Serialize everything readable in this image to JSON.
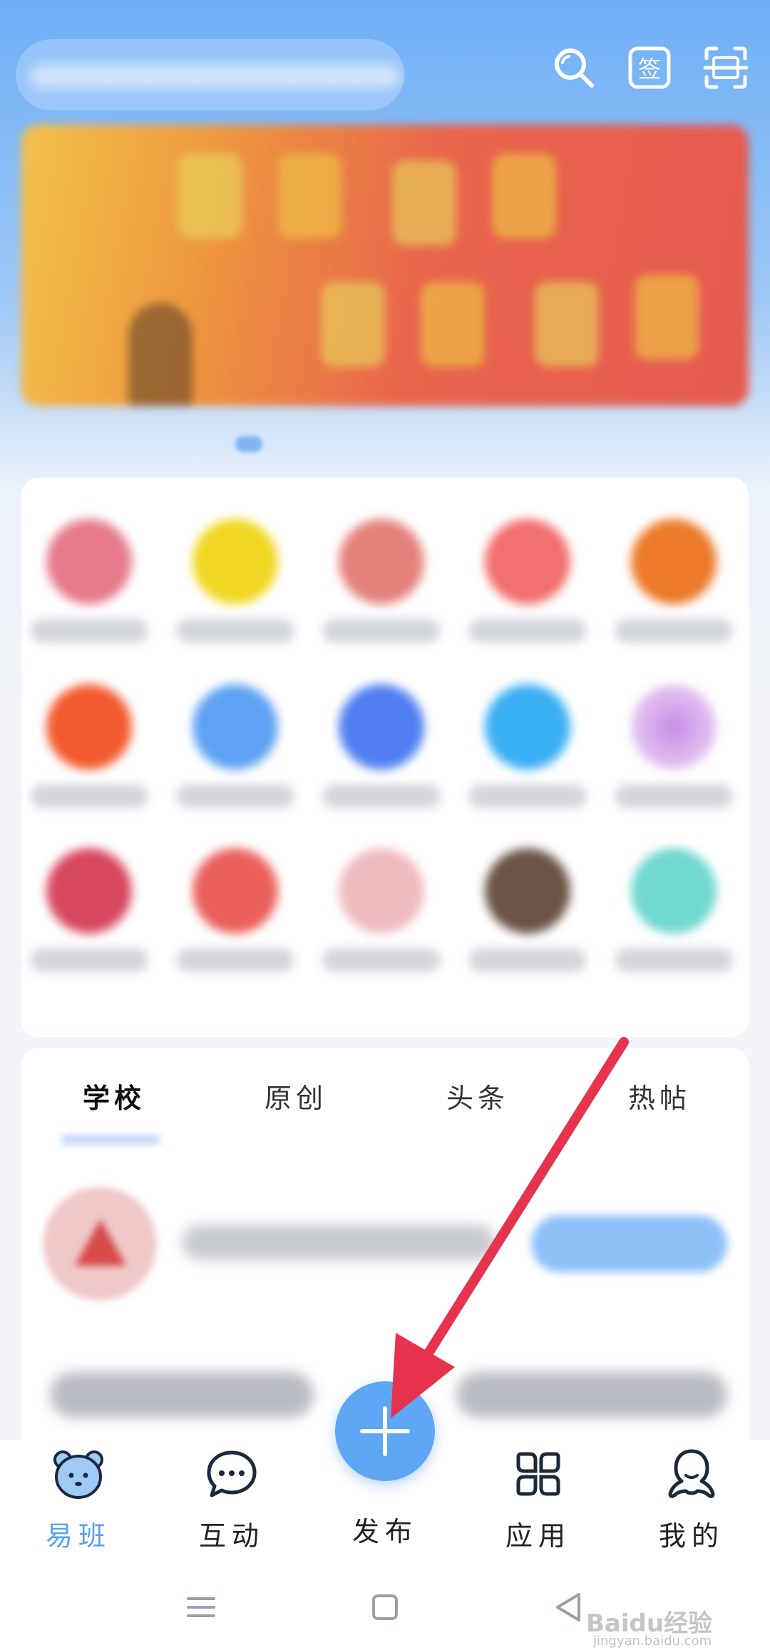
{
  "top_bar": {
    "search_placeholder": "",
    "icons": [
      "search-icon",
      "sign-in-icon",
      "scan-icon"
    ]
  },
  "feed": {
    "tabs": [
      {
        "label": "学校",
        "active": true
      },
      {
        "label": "原创",
        "active": false
      },
      {
        "label": "头条",
        "active": false
      },
      {
        "label": "热帖",
        "active": false
      }
    ]
  },
  "bottom_nav": {
    "items": [
      {
        "label": "易班",
        "icon": "bear-icon",
        "active": true
      },
      {
        "label": "互动",
        "icon": "chat-bubble-icon",
        "active": false
      },
      {
        "label": "发布",
        "icon": "plus-icon",
        "active": false
      },
      {
        "label": "应用",
        "icon": "apps-grid-icon",
        "active": false
      },
      {
        "label": "我的",
        "icon": "profile-icon",
        "active": false
      }
    ]
  },
  "system_nav": {
    "icons": [
      "menu-icon",
      "home-icon",
      "back-icon"
    ]
  },
  "watermark": {
    "brand": "Baidu经验",
    "url": "jingyan.baidu.com"
  },
  "colors": {
    "accent": "#5ea7f4",
    "active_label": "#5aa0ee",
    "annotation_arrow": "#e8334f"
  }
}
